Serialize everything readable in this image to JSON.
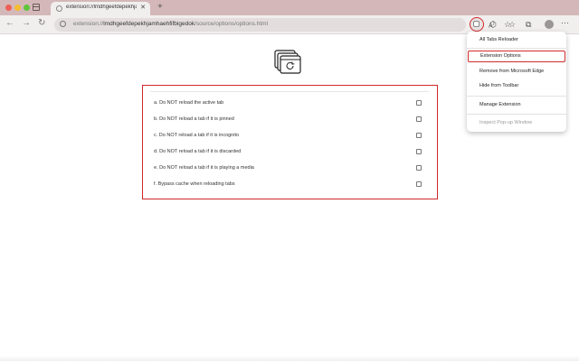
{
  "browser": {
    "tab": {
      "title": "extension://lmdhgeefdepekhjamhaehfifbigedok/source/options/options.html"
    },
    "url": {
      "scheme": "extension://",
      "host": "lmdhgeefdepekhjamhaehfifbigedok",
      "path": "/source/options/options.html"
    }
  },
  "options": [
    {
      "label": "a. Do NOT reload the active tab",
      "checked": false
    },
    {
      "label": "b. Do NOT reload a tab if it is pinned",
      "checked": false
    },
    {
      "label": "c. Do NOT reload a tab if it is incognito",
      "checked": false
    },
    {
      "label": "d. Do NOT reload a tab if it is discarded",
      "checked": false
    },
    {
      "label": "e. Do NOT reload a tab if it is playing a media",
      "checked": false
    },
    {
      "label": "f. Bypass cache when reloading tabs",
      "checked": false
    }
  ],
  "context_menu": {
    "items": [
      {
        "label": "All Tabs Reloader"
      },
      {
        "label": "Extension Options"
      },
      {
        "label": "Remove from Microsoft Edge"
      },
      {
        "label": "Hide from Toolbar"
      },
      {
        "label": "Manage Extension"
      },
      {
        "label": "Inspect Pop-up Window"
      }
    ]
  },
  "colors": {
    "highlight": "#d12a2a",
    "tabbar": "#d4b8b9",
    "toolbar": "#f1eeee"
  }
}
